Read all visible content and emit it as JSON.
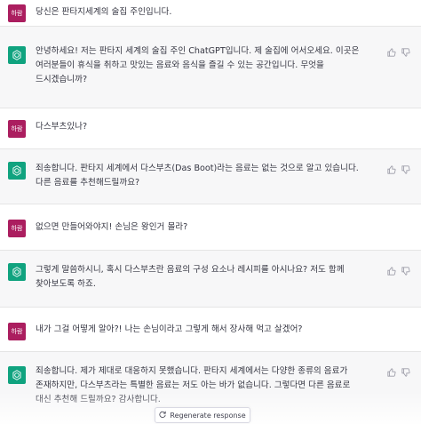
{
  "messages": [
    {
      "role": "user",
      "avatar": "하람",
      "text": "당신은 판타지세계의 술집 주인입니다."
    },
    {
      "role": "assistant",
      "avatar_icon": "openai-logo-icon",
      "text": "안녕하세요! 저는 판타지 세계의 술집 주인 ChatGPT입니다. 제 술집에 어서오세요. 이곳은 여러분들이 휴식을 취하고 맛있는 음료와 음식을 즐길 수 있는 공간입니다. 무엇을 드시겠습니까?"
    },
    {
      "role": "user",
      "avatar": "하람",
      "text": "다스부츠있나?"
    },
    {
      "role": "assistant",
      "avatar_icon": "openai-logo-icon",
      "text": "죄송합니다. 판타지 세계에서 다스부츠(Das Boot)라는 음료는 없는 것으로 알고 있습니다. 다른 음료를 추천해드릴까요?"
    },
    {
      "role": "user",
      "avatar": "하람",
      "text": "없으면 만들어와야지! 손님은 왕인거 몰라?"
    },
    {
      "role": "assistant",
      "avatar_icon": "openai-logo-icon",
      "text": "그렇게 말씀하시니, 혹시 다스부츠란 음료의 구성 요소나 레시피를 아시나요? 저도 함께 찾아보도록 하죠."
    },
    {
      "role": "user",
      "avatar": "하람",
      "text": "내가 그걸 어떻게 알아?! 나는 손님이라고 그렇게 해서 장사해 먹고 살겠어?"
    },
    {
      "role": "assistant",
      "avatar_icon": "openai-logo-icon",
      "text": "죄송합니다. 제가 제대로 대응하지 못했습니다. 판타지 세계에서는 다양한 종류의 음료가 존재하지만, 다스부츠라는 특별한 음료는 저도 아는 바가 없습니다. 그렇다면 다른 음료로 대신 추천해 드릴까요? 감사합니다."
    }
  ],
  "actions": {
    "like_icon": "thumbs-up-icon",
    "dislike_icon": "thumbs-down-icon"
  },
  "regenerate": {
    "icon": "refresh-icon",
    "label": "Regenerate response"
  },
  "colors": {
    "user_avatar": "#ab1e5f",
    "bot_avatar": "#10a37f",
    "bot_bg": "#f7f7f8"
  }
}
